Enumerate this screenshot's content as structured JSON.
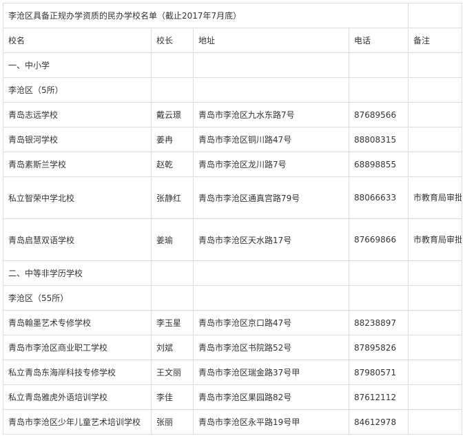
{
  "title": "李沧区具备正规办学资质的民办学校名单（截止2017年7月底）",
  "headers": {
    "name": "校名",
    "principal": "校长",
    "address": "地址",
    "phone": "电话",
    "note": "备注"
  },
  "section1": {
    "label": "一、中小学",
    "district": "李沧区（5所）"
  },
  "section2": {
    "label": "二、中等非学历学校",
    "district": "李沧区（55所）"
  },
  "rows1": [
    {
      "name": "青岛志远学校",
      "principal": "戴云璟",
      "address": "青岛市李沧区九水东路7号",
      "phone": "87689566",
      "note": ""
    },
    {
      "name": "青岛银河学校",
      "principal": "姜冉",
      "address": "青岛市李沧区铜川路47号",
      "phone": "88808315",
      "note": ""
    },
    {
      "name": "青岛素斯兰学校",
      "principal": "赵乾",
      "address": "青岛市李沧区龙川路7号",
      "phone": "68898855",
      "note": ""
    },
    {
      "name": "私立智荣中学北校",
      "principal": "张静红",
      "address": "青岛市李沧区通真宫路79号",
      "phone": "88066633",
      "note": "市教育局审批"
    },
    {
      "name": "青岛启慧双语学校",
      "principal": "姜瑜",
      "address": "青岛市李沧区天水路17号",
      "phone": "87669866",
      "note": "市教育局审批"
    }
  ],
  "rows2": [
    {
      "name": "青岛翰墨艺术专修学校",
      "principal": "李玉星",
      "address": "青岛市李沧区京口路47号",
      "phone": "88238897",
      "note": ""
    },
    {
      "name": "青岛市李沧区商业职工学校",
      "principal": "刘斌",
      "address": "青岛市李沧区书院路52号",
      "phone": "87895826",
      "note": ""
    },
    {
      "name": "私立青岛东海岸科技专修学校",
      "principal": "王文丽",
      "address": "青岛市李沧区瑞金路37号甲",
      "phone": "87980571",
      "note": ""
    },
    {
      "name": "私立青岛雅虎外语培训学校",
      "principal": "李佳",
      "address": "青岛市李沧区果园路82号",
      "phone": "87612112",
      "note": ""
    },
    {
      "name": "青岛市李沧区少年儿童艺术培训学校",
      "principal": "张丽",
      "address": "青岛市李沧区永平路19号甲",
      "phone": "84612978",
      "note": ""
    }
  ]
}
